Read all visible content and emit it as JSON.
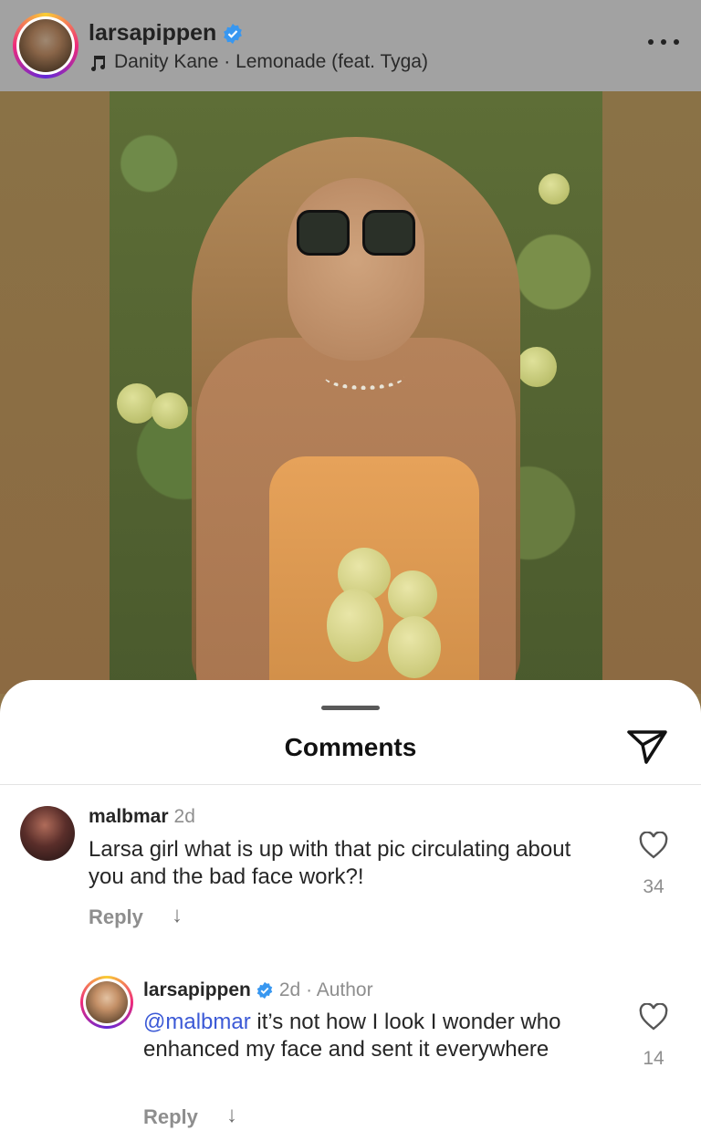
{
  "post": {
    "username": "larsapippen",
    "music": "Danity Kane · Lemonade (feat. Tyga)"
  },
  "sheet": {
    "title": "Comments"
  },
  "comments": [
    {
      "username": "malbmar",
      "time": "2d",
      "text": "Larsa girl what is up with that pic circulating about you and the bad face work?!",
      "likes": "34",
      "reply_label": "Reply"
    },
    {
      "username": "larsapippen",
      "meta": "2d · Author",
      "mention": "@malbmar",
      "text": " it’s not how I look I wonder who enhanced my face and sent it everywhere",
      "likes": "14",
      "reply_label": "Reply"
    }
  ],
  "colors": {
    "verified": "#3897f0",
    "mention": "#3b59d6"
  }
}
